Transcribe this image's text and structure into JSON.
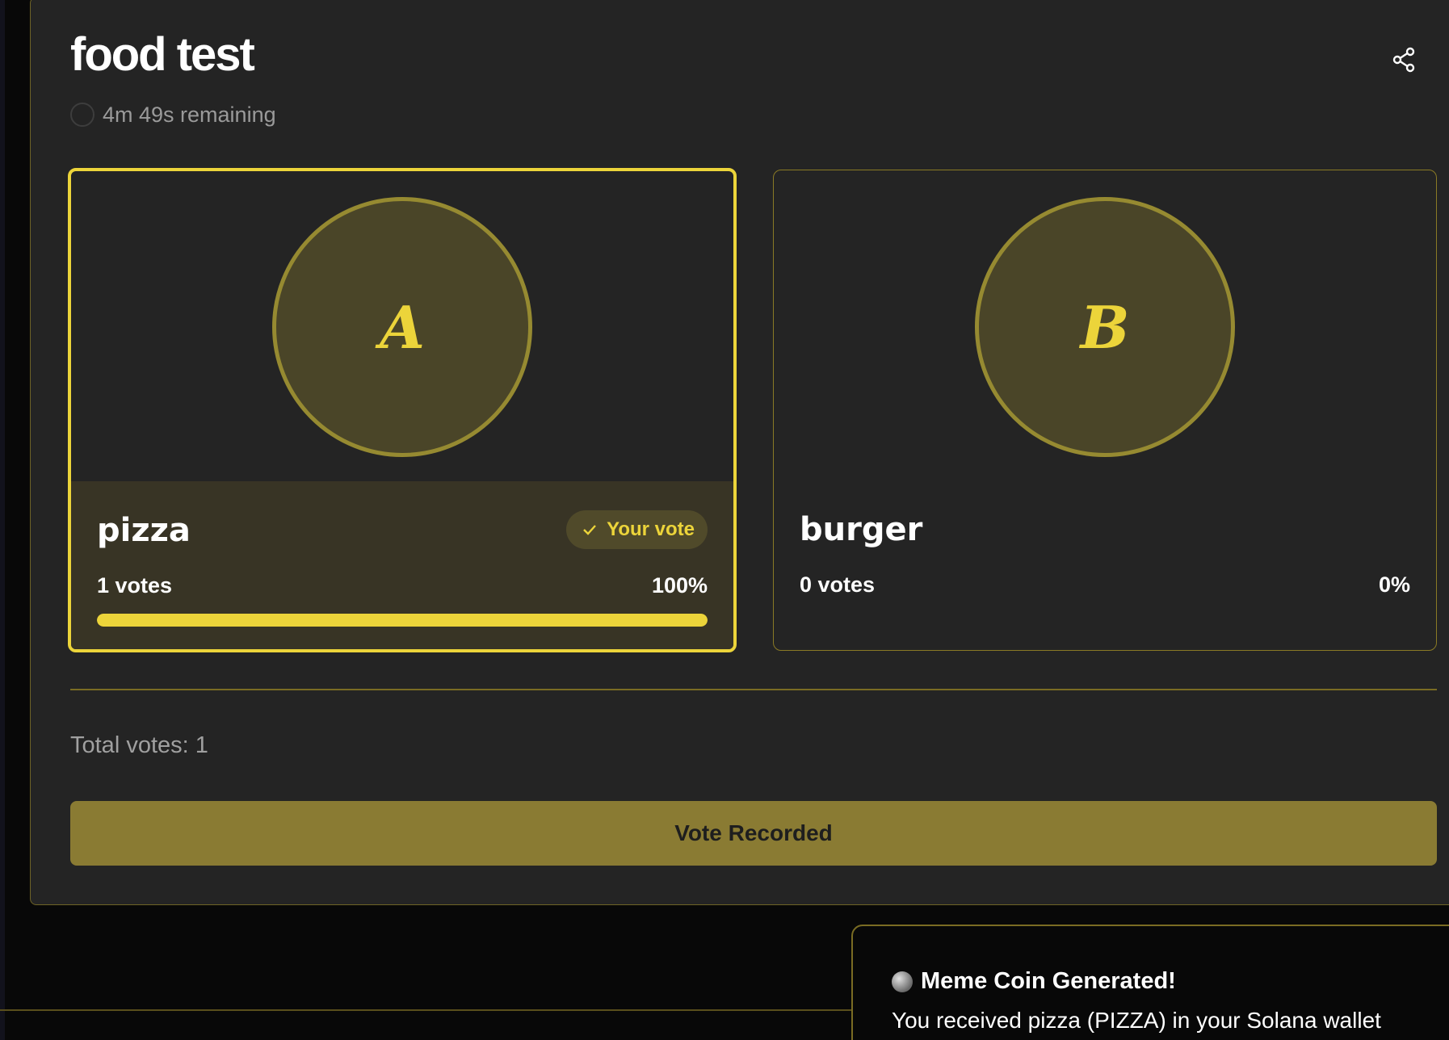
{
  "poll": {
    "title": "food test",
    "timer_text": "4m 49s remaining",
    "total_votes_text": "Total votes: 1",
    "status_button_label": "Vote Recorded"
  },
  "options": [
    {
      "letter": "A",
      "name": "pizza",
      "votes_text": "1 votes",
      "percent_text": "100%",
      "progress_fraction": 1.0,
      "selected": true,
      "your_vote_label": "Your vote"
    },
    {
      "letter": "B",
      "name": "burger",
      "votes_text": "0 votes",
      "percent_text": "0%",
      "progress_fraction": 0.0,
      "selected": false
    }
  ],
  "toast": {
    "title": "Meme Coin Generated!",
    "body": "You received pizza (PIZZA) in your Solana wallet",
    "icon": "moon-icon"
  },
  "icons": {
    "share": "share-icon",
    "timer": "timer-icon",
    "check": "check-icon"
  },
  "colors": {
    "accent": "#ecd43a",
    "panel": "#242424",
    "background": "#080808",
    "button": "#8a7b33"
  }
}
